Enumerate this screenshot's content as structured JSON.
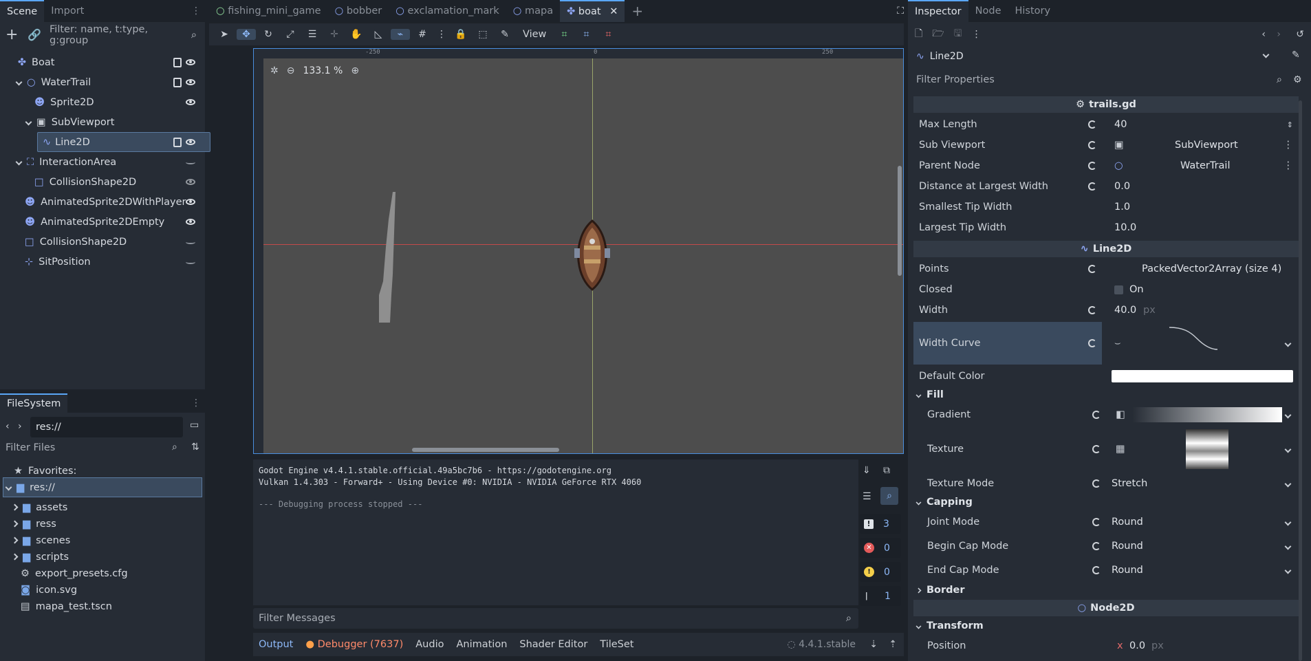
{
  "scene_panel": {
    "tabs": [
      "Scene",
      "Import"
    ],
    "filter_placeholder": "Filter: name, t:type, g:group",
    "nodes": [
      {
        "name": "Boat",
        "icon": "node2d-icon"
      },
      {
        "name": "WaterTrail",
        "icon": "circle-icon"
      },
      {
        "name": "Sprite2D",
        "icon": "sprite-icon"
      },
      {
        "name": "SubViewport",
        "icon": "viewport-icon"
      },
      {
        "name": "Line2D",
        "icon": "line2d-icon"
      },
      {
        "name": "InteractionArea",
        "icon": "area-icon"
      },
      {
        "name": "CollisionShape2D",
        "icon": "shape-icon"
      },
      {
        "name": "AnimatedSprite2DWithPlayer",
        "icon": "animated-sprite-icon"
      },
      {
        "name": "AnimatedSprite2DEmpty",
        "icon": "animated-sprite-icon"
      },
      {
        "name": "CollisionShape2D",
        "icon": "shape-icon"
      },
      {
        "name": "SitPosition",
        "icon": "marker-icon"
      }
    ]
  },
  "filesystem": {
    "tab": "FileSystem",
    "path": "res://",
    "filter_placeholder": "Filter Files",
    "favorites_label": "Favorites:",
    "root": "res://",
    "items": [
      {
        "name": "assets",
        "type": "folder"
      },
      {
        "name": "ress",
        "type": "folder"
      },
      {
        "name": "scenes",
        "type": "folder"
      },
      {
        "name": "scripts",
        "type": "folder"
      },
      {
        "name": "export_presets.cfg",
        "type": "file"
      },
      {
        "name": "icon.svg",
        "type": "file"
      },
      {
        "name": "mapa_test.tscn",
        "type": "file"
      }
    ]
  },
  "editor_tabs": [
    "fishing_mini_game",
    "bobber",
    "exclamation_mark",
    "mapa",
    "boat"
  ],
  "toolbar": {
    "view_label": "View"
  },
  "viewport": {
    "zoom": "133.1 %",
    "ruler_labels": [
      "-250",
      "0",
      "250"
    ]
  },
  "output": {
    "lines": [
      "Godot Engine v4.4.1.stable.official.49a5bc7b6 - https://godotengine.org",
      "Vulkan 1.4.303 - Forward+ - Using Device #0: NVIDIA - NVIDIA GeForce RTX 4060",
      "",
      "--- Debugging process stopped ---"
    ],
    "filter_placeholder": "Filter Messages",
    "counters": [
      "3",
      "0",
      "0",
      "1"
    ]
  },
  "bottom_tabs": [
    "Output",
    "Debugger (7637)",
    "Audio",
    "Animation",
    "Shader Editor",
    "TileSet"
  ],
  "version": "4.4.1.stable",
  "inspector": {
    "tabs": [
      "Inspector",
      "Node",
      "History"
    ],
    "node": "Line2D",
    "filter_placeholder": "Filter Properties",
    "script_section": "trails.gd",
    "script_props": [
      {
        "name": "Max Length",
        "value": "40"
      },
      {
        "name": "Sub Viewport",
        "value": "SubViewport"
      },
      {
        "name": "Parent Node",
        "value": "WaterTrail"
      },
      {
        "name": "Distance at Largest Width",
        "value": "0.0"
      },
      {
        "name": "Smallest Tip Width",
        "value": "1.0"
      },
      {
        "name": "Largest Tip Width",
        "value": "10.0"
      }
    ],
    "line2d_section": "Line2D",
    "points": {
      "name": "Points",
      "value": "PackedVector2Array (size 4)"
    },
    "closed": {
      "name": "Closed",
      "value": "On"
    },
    "width": {
      "name": "Width",
      "value": "40.0",
      "unit": "px"
    },
    "width_curve": {
      "name": "Width Curve"
    },
    "default_color": {
      "name": "Default Color"
    },
    "fill_group": "Fill",
    "gradient": {
      "name": "Gradient"
    },
    "texture": {
      "name": "Texture"
    },
    "texture_mode": {
      "name": "Texture Mode",
      "value": "Stretch"
    },
    "capping_group": "Capping",
    "joint_mode": {
      "name": "Joint Mode",
      "value": "Round"
    },
    "begin_cap": {
      "name": "Begin Cap Mode",
      "value": "Round"
    },
    "end_cap": {
      "name": "End Cap Mode",
      "value": "Round"
    },
    "border_group": "Border",
    "node2d_section": "Node2D",
    "transform_group": "Transform",
    "position": {
      "name": "Position",
      "axis": "x",
      "value": "0.0",
      "unit": "px"
    }
  }
}
